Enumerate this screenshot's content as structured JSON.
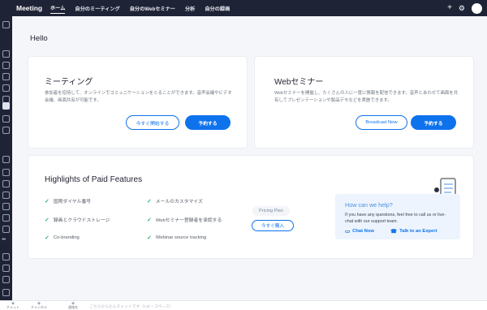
{
  "app": {
    "name": "Meeting"
  },
  "nav": [
    {
      "label": "ホーム",
      "active": true
    },
    {
      "label": "自分のミーティング",
      "active": false
    },
    {
      "label": "自分のWebセミナー",
      "active": false
    },
    {
      "label": "分析",
      "active": false
    },
    {
      "label": "自分の録画",
      "active": false
    }
  ],
  "topbar": {
    "add_icon": "plus-icon",
    "settings_icon": "gear-icon"
  },
  "greeting": "Hello",
  "meeting_card": {
    "title": "ミーティング",
    "description": "参加者を招待して、オンラインでコミュニケーションをとることができます。音声会議やビデオ会議、画面共有が可能です。",
    "start_label": "今すぐ開始する",
    "schedule_label": "予約する"
  },
  "webinar_card": {
    "title": "Webセミナー",
    "description": "Webセミナーを開催し、たくさんの人に一度に情報を配信できます。音声とあわせて画面を共有してプレゼンテーションや製品デモなどを実施できます。",
    "broadcast_label": "Broadcast Now",
    "schedule_label": "予約する"
  },
  "highlights": {
    "title": "Highlights of Paid Features",
    "features_left": [
      "国際ダイヤル番号",
      "録画とクラウドストレージ",
      "Co-branding"
    ],
    "features_right": [
      "メールのカスタマイズ",
      "Webセミナー登録者を承認する",
      "Webinar source tracking"
    ],
    "pricing_label": "Pricing Plan",
    "buy_label": "今すぐ購入"
  },
  "help": {
    "title": "How can we help?",
    "description": "If you have any questions, feel free to call us or live-chat with our support team.",
    "chat_label": "Chat Now",
    "expert_label": "Talk to an Expert"
  },
  "bottombar": {
    "items": [
      "チャット",
      "チャンネル",
      "連絡先"
    ],
    "input_placeholder": "こちらからたんチャットです（Ctrl + スペース）"
  },
  "colors": {
    "topbar": "#1f2336",
    "accent": "#0e72ed",
    "check": "#2fb36a",
    "help_bg": "#edf4fd"
  }
}
